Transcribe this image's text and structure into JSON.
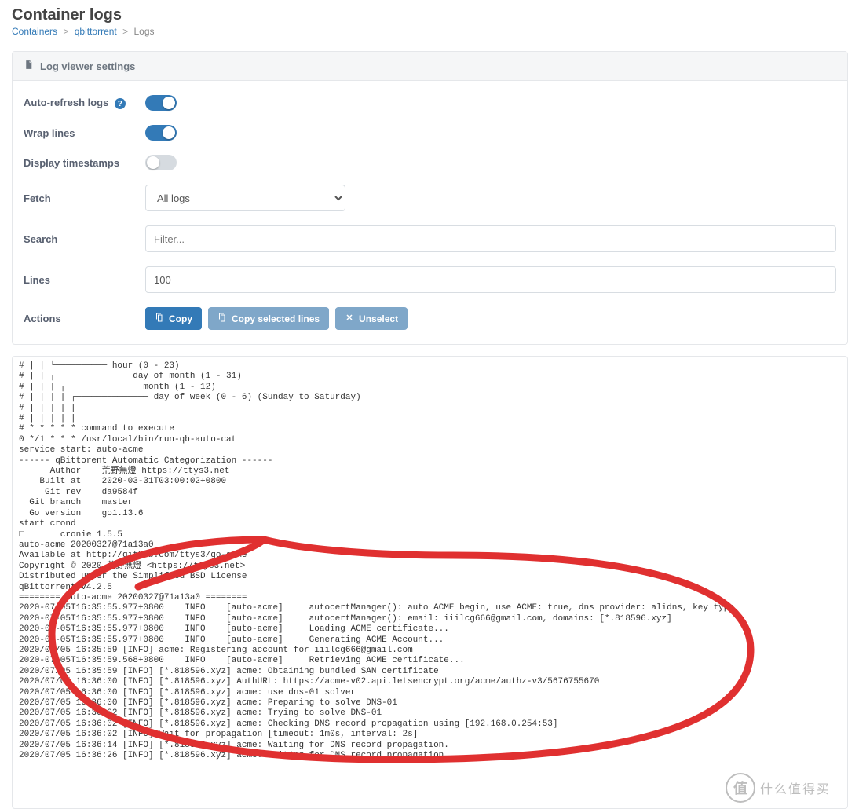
{
  "page": {
    "title": "Container logs"
  },
  "breadcrumb": {
    "containers": "Containers",
    "container_name": "qbittorrent",
    "current": "Logs"
  },
  "panel": {
    "header": "Log viewer settings"
  },
  "settings": {
    "auto_refresh": {
      "label": "Auto-refresh logs",
      "value": true
    },
    "wrap_lines": {
      "label": "Wrap lines",
      "value": true
    },
    "timestamps": {
      "label": "Display timestamps",
      "value": false
    },
    "fetch": {
      "label": "Fetch",
      "selected": "All logs",
      "options": [
        "All logs"
      ]
    },
    "search": {
      "label": "Search",
      "placeholder": "Filter...",
      "value": ""
    },
    "lines": {
      "label": "Lines",
      "value": "100"
    },
    "actions": {
      "label": "Actions",
      "copy": "Copy",
      "copy_selected": "Copy selected lines",
      "unselect": "Unselect"
    }
  },
  "logs": [
    "# | | └────────── hour (0 - 23)",
    "# | | ┌────────────── day of month (1 - 31)",
    "# | | | ┌────────────── month (1 - 12)",
    "# | | | | ┌────────────── day of week (0 - 6) (Sunday to Saturday)",
    "# | | | | |",
    "# | | | | |",
    "# * * * * * command to execute",
    "0 */1 * * * /usr/local/bin/run-qb-auto-cat",
    "service start: auto-acme",
    "------ qBittorent Automatic Categorization ------",
    "      Author    荒野無燈 https://ttys3.net",
    "    Built at    2020-03-31T03:00:02+0800",
    "     Git rev    da9584f",
    "  Git branch    master",
    "  Go version    go1.13.6",
    "start crond",
    "□       cronie 1.5.5",
    "auto-acme 20200327@71a13a0",
    "Available at http://github.com/ttys3/go-acme",
    "Copyright © 2020 荒野無燈 <https://ttys3.net>",
    "Distributed under the Simplified BSD License",
    "qBittorrent v4.2.5",
    "======== auto-acme 20200327@71a13a0 ========",
    "2020-07-05T16:35:55.977+0800    INFO    [auto-acme]     autocertManager(): auto ACME begin, use ACME: true, dns provider: alidns, key type",
    "2020-07-05T16:35:55.977+0800    INFO    [auto-acme]     autocertManager(): email: iiilcg666@gmail.com, domains: [*.818596.xyz]",
    "2020-07-05T16:35:55.977+0800    INFO    [auto-acme]     Loading ACME certificate...",
    "2020-07-05T16:35:55.977+0800    INFO    [auto-acme]     Generating ACME Account...",
    "2020/07/05 16:35:59 [INFO] acme: Registering account for iiilcg666@gmail.com",
    "2020-07-05T16:35:59.568+0800    INFO    [auto-acme]     Retrieving ACME certificate...",
    "2020/07/05 16:35:59 [INFO] [*.818596.xyz] acme: Obtaining bundled SAN certificate",
    "2020/07/05 16:36:00 [INFO] [*.818596.xyz] AuthURL: https://acme-v02.api.letsencrypt.org/acme/authz-v3/5676755670",
    "2020/07/05 16:36:00 [INFO] [*.818596.xyz] acme: use dns-01 solver",
    "2020/07/05 16:36:00 [INFO] [*.818596.xyz] acme: Preparing to solve DNS-01",
    "2020/07/05 16:36:02 [INFO] [*.818596.xyz] acme: Trying to solve DNS-01",
    "2020/07/05 16:36:02 [INFO] [*.818596.xyz] acme: Checking DNS record propagation using [192.168.0.254:53]",
    "2020/07/05 16:36:02 [INFO] Wait for propagation [timeout: 1m0s, interval: 2s]",
    "2020/07/05 16:36:14 [INFO] [*.818596.xyz] acme: Waiting for DNS record propagation.",
    "2020/07/05 16:36:26 [INFO] [*.818596.xyz] acme: Waiting for DNS record propagation."
  ],
  "watermark": {
    "badge": "值",
    "text": "什么值得买"
  }
}
